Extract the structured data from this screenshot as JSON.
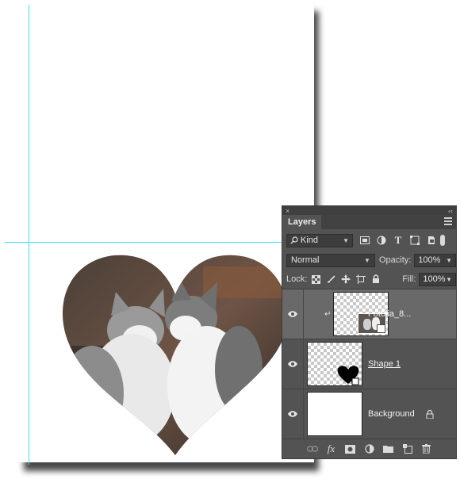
{
  "panel": {
    "title": "Layers",
    "close_glyph": "×",
    "collapse_glyph": "‹‹",
    "kind_filter": {
      "icon": "search-icon",
      "label": "Kind",
      "filter_icons": [
        "pixel-layer-filter-icon",
        "adjustment-filter-icon",
        "type-filter-icon",
        "shape-filter-icon",
        "smart-object-filter-icon"
      ]
    },
    "blend_mode": "Normal",
    "opacity_label": "Opacity:",
    "opacity_value": "100%",
    "lock_label": "Lock:",
    "lock_icons": [
      "lock-transparent-pixels-icon",
      "lock-image-pixels-icon",
      "lock-position-icon",
      "lock-artboard-icon",
      "lock-all-icon"
    ],
    "fill_label": "Fill:",
    "fill_value": "100%",
    "layers": [
      {
        "name": "Fotolia_8...",
        "selected": true,
        "clipped": true,
        "visible": true,
        "type": "smart-object"
      },
      {
        "name": "Shape 1",
        "selected": false,
        "visible": true,
        "type": "shape"
      },
      {
        "name": "Background",
        "selected": false,
        "visible": true,
        "locked": true,
        "type": "background"
      }
    ],
    "bottom_icons": [
      "link-layers-icon",
      "fx-icon",
      "add-mask-icon",
      "adjustment-layer-icon",
      "new-group-icon",
      "new-layer-icon",
      "trash-icon"
    ]
  },
  "colors": {
    "guide": "#3be0f0",
    "panel_bg": "#535353",
    "selected_layer": "#696969"
  }
}
